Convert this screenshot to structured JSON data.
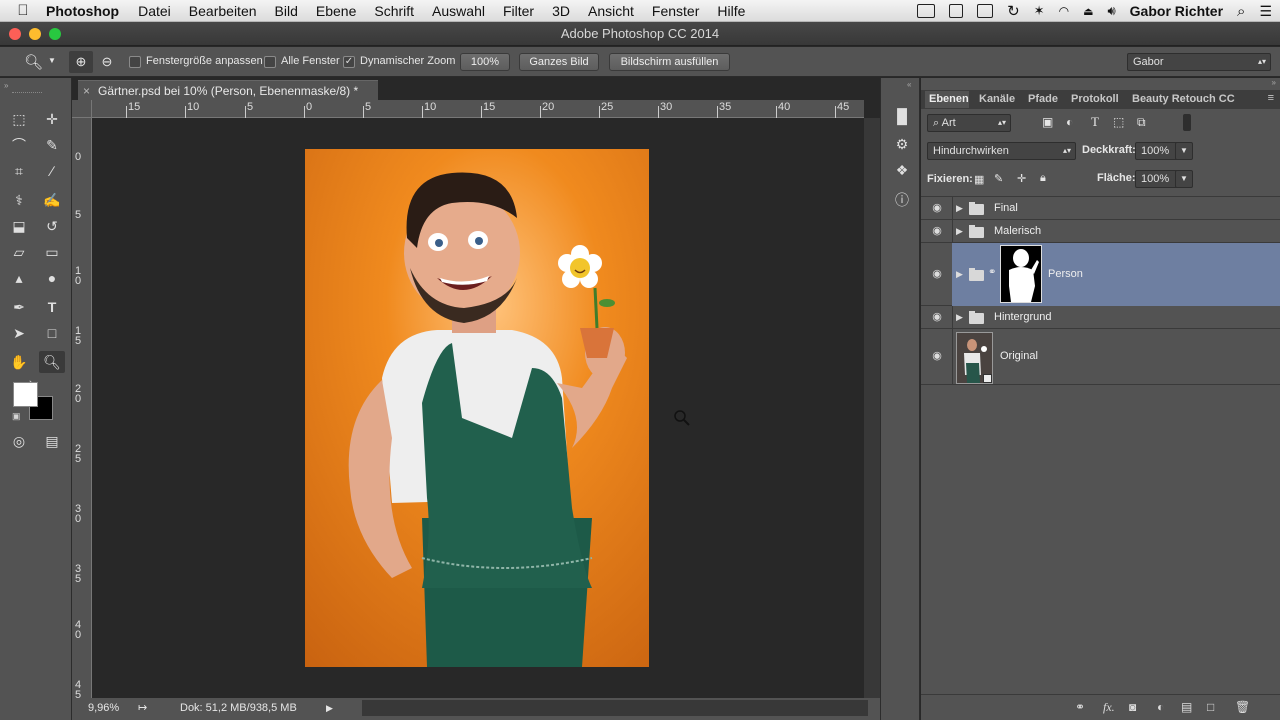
{
  "menubar": {
    "app_name": "Photoshop",
    "items": [
      "Datei",
      "Bearbeiten",
      "Bild",
      "Ebene",
      "Schrift",
      "Auswahl",
      "Filter",
      "3D",
      "Ansicht",
      "Fenster",
      "Hilfe"
    ],
    "user": "Gabor Richter"
  },
  "window": {
    "title": "Adobe Photoshop CC 2014"
  },
  "options": {
    "fit_window": "Fenstergröße anpassen",
    "all_windows": "Alle Fenster",
    "dynamic_zoom": "Dynamischer Zoom",
    "zoom_value": "100%",
    "whole_image": "Ganzes Bild",
    "fill_screen": "Bildschirm ausfüllen",
    "workspace": "Gabor"
  },
  "document": {
    "tab_title": "Gärtner.psd bei 10% (Person, Ebenenmaske/8) *",
    "ruler_h": [
      "15",
      "10",
      "5",
      "0",
      "5",
      "10",
      "15",
      "20",
      "25",
      "30",
      "35",
      "40",
      "45"
    ],
    "ruler_v": [
      "0",
      "5",
      "1\n0",
      "1\n5",
      "2\n0",
      "2\n5",
      "3\n0",
      "3\n5",
      "4\n0",
      "4\n5"
    ]
  },
  "status": {
    "zoom": "9,96%",
    "doc_size": "Dok: 51,2 MB/938,5 MB"
  },
  "panel": {
    "tabs": [
      "Ebenen",
      "Kanäle",
      "Pfade",
      "Protokoll",
      "Beauty Retouch CC"
    ],
    "filter_kind": "Art",
    "blend_mode": "Hindurchwirken",
    "opacity_label": "Deckkraft:",
    "opacity_value": "100%",
    "lock_label": "Fixieren:",
    "fill_label": "Fläche:",
    "fill_value": "100%",
    "layers": [
      {
        "name": "Final"
      },
      {
        "name": "Malerisch"
      },
      {
        "name": "Person"
      },
      {
        "name": "Hintergrund"
      },
      {
        "name": "Original"
      }
    ]
  },
  "colors": {
    "accent": "#6e7fa1",
    "canvas_bg": "#d46f12"
  }
}
